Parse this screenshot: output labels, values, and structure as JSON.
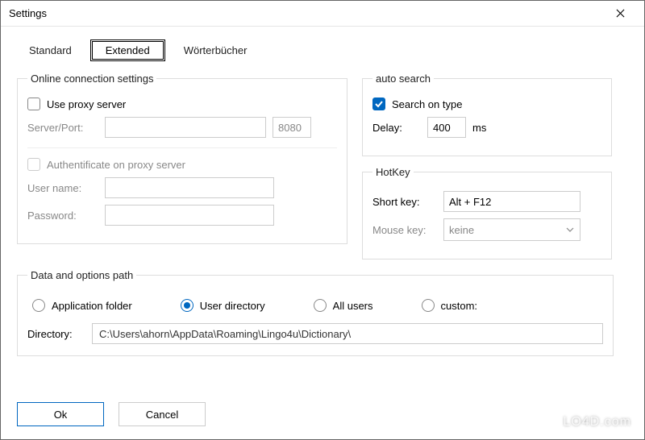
{
  "window": {
    "title": "Settings"
  },
  "tabs": {
    "standard": "Standard",
    "extended": "Extended",
    "worterbucher": "Wörterbücher"
  },
  "online": {
    "legend": "Online connection settings",
    "use_proxy_label": "Use proxy server",
    "server_port_label": "Server/Port:",
    "server_value": "",
    "port_value": "8080",
    "auth_proxy_label": "Authentificate on proxy server",
    "username_label": "User name:",
    "username_value": "",
    "password_label": "Password:",
    "password_value": ""
  },
  "autosearch": {
    "legend": "auto search",
    "search_on_type_label": "Search on type",
    "delay_label": "Delay:",
    "delay_value": "400",
    "delay_unit": "ms"
  },
  "hotkey": {
    "legend": "HotKey",
    "short_key_label": "Short key:",
    "short_key_value": "Alt + F12",
    "mouse_key_label": "Mouse key:",
    "mouse_key_value": "keine"
  },
  "datapath": {
    "legend": "Data and options path",
    "application_folder": "Application folder",
    "user_directory": "User directory",
    "all_users": "All users",
    "custom": "custom:",
    "directory_label": "Directory:",
    "directory_value": "C:\\Users\\ahorn\\AppData\\Roaming\\Lingo4u\\Dictionary\\"
  },
  "buttons": {
    "ok": "Ok",
    "cancel": "Cancel"
  },
  "watermark": "LO4D.com"
}
